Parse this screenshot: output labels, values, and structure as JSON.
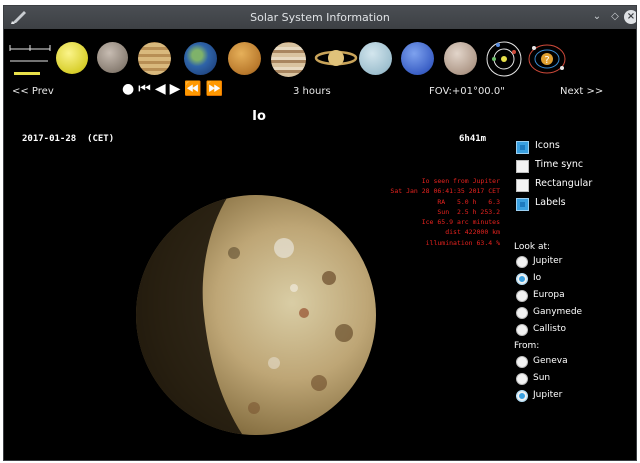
{
  "window": {
    "title": "Solar System Information"
  },
  "planets": [
    {
      "name": "Sun",
      "color": "#e8e04a"
    },
    {
      "name": "Mercury",
      "color": "#9a8f85"
    },
    {
      "name": "Venus",
      "color": "#c9a76a"
    },
    {
      "name": "Earth",
      "color": "#3a6fb0"
    },
    {
      "name": "Mars",
      "color": "#c98a3a"
    },
    {
      "name": "Jupiter",
      "color": "#c9ab83"
    },
    {
      "name": "Saturn",
      "color": "#d8b56a"
    },
    {
      "name": "Uranus",
      "color": "#a9c8d6"
    },
    {
      "name": "Neptune",
      "color": "#3f66c9"
    },
    {
      "name": "Pluto",
      "color": "#b7a293"
    }
  ],
  "nav": {
    "prev_label": "<< Prev",
    "next_label": "Next >>"
  },
  "time_step": "3 hours",
  "fov": "FOV:+01°00.0\"",
  "body_name": "Io",
  "date": "2017-01-28  (CET)",
  "clock": "6h41m",
  "info_lines": [
    "Io seen from Jupiter",
    "Sat Jan 28 06:41:35 2017 CET",
    "RA   5.0 h   6.3",
    "Sun  2.5 h 253.2",
    "Ice 65.9 arc minutes",
    "dist 422000 km",
    "illumination 63.4 %"
  ],
  "options": [
    {
      "label": "Icons",
      "checked": true
    },
    {
      "label": "Time sync",
      "checked": false
    },
    {
      "label": "Rectangular",
      "checked": false
    },
    {
      "label": "Labels",
      "checked": true
    }
  ],
  "look_at": {
    "label": "Look at:",
    "items": [
      {
        "label": "Jupiter",
        "selected": false
      },
      {
        "label": "Io",
        "selected": true
      },
      {
        "label": "Europa",
        "selected": false
      },
      {
        "label": "Ganymede",
        "selected": false
      },
      {
        "label": "Callisto",
        "selected": false
      }
    ]
  },
  "from": {
    "label": "From:",
    "items": [
      {
        "label": "Geneva",
        "selected": false
      },
      {
        "label": "Sun",
        "selected": false
      },
      {
        "label": "Jupiter",
        "selected": true
      }
    ]
  }
}
